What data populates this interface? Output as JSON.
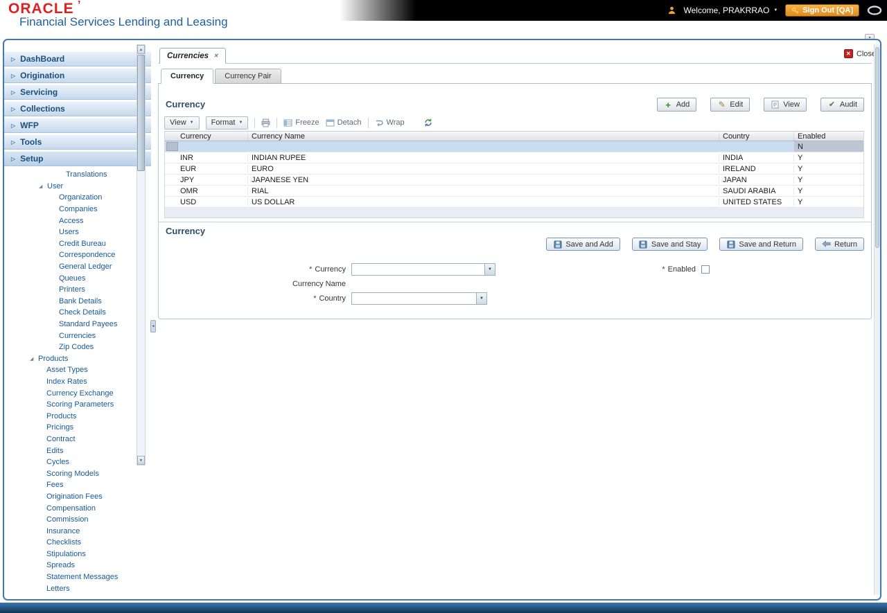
{
  "icons": {
    "logo_mark": "’",
    "nav_arrow": "▷",
    "tree_expanded": "◢",
    "dropdown_caret": "▼",
    "menu_caret": "▼",
    "welcome_caret": "▼",
    "tab_close": "✕",
    "close_x": "✕",
    "collapse_up": "▲",
    "pane_collapse": "◄",
    "scroll_up": "▲",
    "scroll_down": "▼",
    "required_marker": "*",
    "add_glyph": "+",
    "edit_glyph": "✎",
    "audit_glyph": "✔"
  },
  "header": {
    "logo": "ORACLE",
    "product": "Financial Services Lending and Leasing",
    "welcome": "Welcome, PRAKRRAO",
    "sign_out": "Sign Out [QA]"
  },
  "sidebar": {
    "nav": [
      {
        "label": "DashBoard"
      },
      {
        "label": "Origination"
      },
      {
        "label": "Servicing"
      },
      {
        "label": "Collections"
      },
      {
        "label": "WFP"
      },
      {
        "label": "Tools"
      },
      {
        "label": "Setup",
        "active": true
      }
    ],
    "tree": [
      {
        "label": "Translations",
        "lvl": 4
      },
      {
        "label": "User",
        "lvl": 1,
        "expandable": true
      },
      {
        "label": "Organization",
        "lvl": 3
      },
      {
        "label": "Companies",
        "lvl": 3
      },
      {
        "label": "Access",
        "lvl": 3
      },
      {
        "label": "Users",
        "lvl": 3
      },
      {
        "label": "Credit Bureau",
        "lvl": 3
      },
      {
        "label": "Correspondence",
        "lvl": 3
      },
      {
        "label": "General Ledger",
        "lvl": 3
      },
      {
        "label": "Queues",
        "lvl": 3
      },
      {
        "label": "Printers",
        "lvl": 3
      },
      {
        "label": "Bank Details",
        "lvl": 3
      },
      {
        "label": "Check Details",
        "lvl": 3
      },
      {
        "label": "Standard Payees",
        "lvl": 3
      },
      {
        "label": "Currencies",
        "lvl": 3
      },
      {
        "label": "Zip Codes",
        "lvl": 3
      },
      {
        "label": "Products",
        "lvl": 0,
        "expandable": true
      },
      {
        "label": "Asset Types",
        "lvl": 2
      },
      {
        "label": "Index Rates",
        "lvl": 2
      },
      {
        "label": "Currency Exchange",
        "lvl": 2
      },
      {
        "label": "Scoring Parameters",
        "lvl": 2
      },
      {
        "label": "Products",
        "lvl": 2
      },
      {
        "label": "Pricings",
        "lvl": 2
      },
      {
        "label": "Contract",
        "lvl": 2
      },
      {
        "label": "Edits",
        "lvl": 2
      },
      {
        "label": "Cycles",
        "lvl": 2
      },
      {
        "label": "Scoring Models",
        "lvl": 2
      },
      {
        "label": "Fees",
        "lvl": 2
      },
      {
        "label": "Origination Fees",
        "lvl": 2
      },
      {
        "label": "Compensation",
        "lvl": 2
      },
      {
        "label": "Commission",
        "lvl": 2
      },
      {
        "label": "Insurance",
        "lvl": 2
      },
      {
        "label": "Checklists",
        "lvl": 2
      },
      {
        "label": "Stipulations",
        "lvl": 2
      },
      {
        "label": "Spreads",
        "lvl": 2
      },
      {
        "label": "Statement Messages",
        "lvl": 2
      },
      {
        "label": "Letters",
        "lvl": 2
      }
    ]
  },
  "workspace": {
    "doc_tab": "Currencies",
    "close_label": "Close",
    "sub_tabs": [
      {
        "label": "Currency",
        "active": true
      },
      {
        "label": "Currency Pair",
        "active": false
      }
    ]
  },
  "grid": {
    "title": "Currency",
    "actions": [
      {
        "label": "Add"
      },
      {
        "label": "Edit"
      },
      {
        "label": "View"
      },
      {
        "label": "Audit"
      }
    ],
    "toolbar": {
      "view": "View",
      "format": "Format",
      "freeze": "Freeze",
      "detach": "Detach",
      "wrap": "Wrap"
    },
    "columns": [
      "Currency",
      "Currency Name",
      "Country",
      "Enabled"
    ],
    "rows": [
      {
        "currency": "",
        "currency_name": "",
        "country": "",
        "enabled": "N",
        "selected": true
      },
      {
        "currency": "INR",
        "currency_name": "INDIAN RUPEE",
        "country": "INDIA",
        "enabled": "Y"
      },
      {
        "currency": "EUR",
        "currency_name": "EURO",
        "country": "IRELAND",
        "enabled": "Y"
      },
      {
        "currency": "JPY",
        "currency_name": "JAPANESE YEN",
        "country": "JAPAN",
        "enabled": "Y"
      },
      {
        "currency": "OMR",
        "currency_name": "RIAL",
        "country": "SAUDI ARABIA",
        "enabled": "Y"
      },
      {
        "currency": "USD",
        "currency_name": "US DOLLAR",
        "country": "UNITED STATES",
        "enabled": "Y"
      }
    ]
  },
  "form": {
    "title": "Currency",
    "buttons": [
      {
        "label": "Save and Add"
      },
      {
        "label": "Save and Stay"
      },
      {
        "label": "Save and Return"
      },
      {
        "label": "Return"
      }
    ],
    "fields": {
      "currency": {
        "label": "Currency",
        "required": true,
        "value": ""
      },
      "currency_name": {
        "label": "Currency Name",
        "required": false
      },
      "country": {
        "label": "Country",
        "required": true,
        "value": ""
      },
      "enabled": {
        "label": "Enabled",
        "required": true,
        "checked": false
      }
    }
  }
}
